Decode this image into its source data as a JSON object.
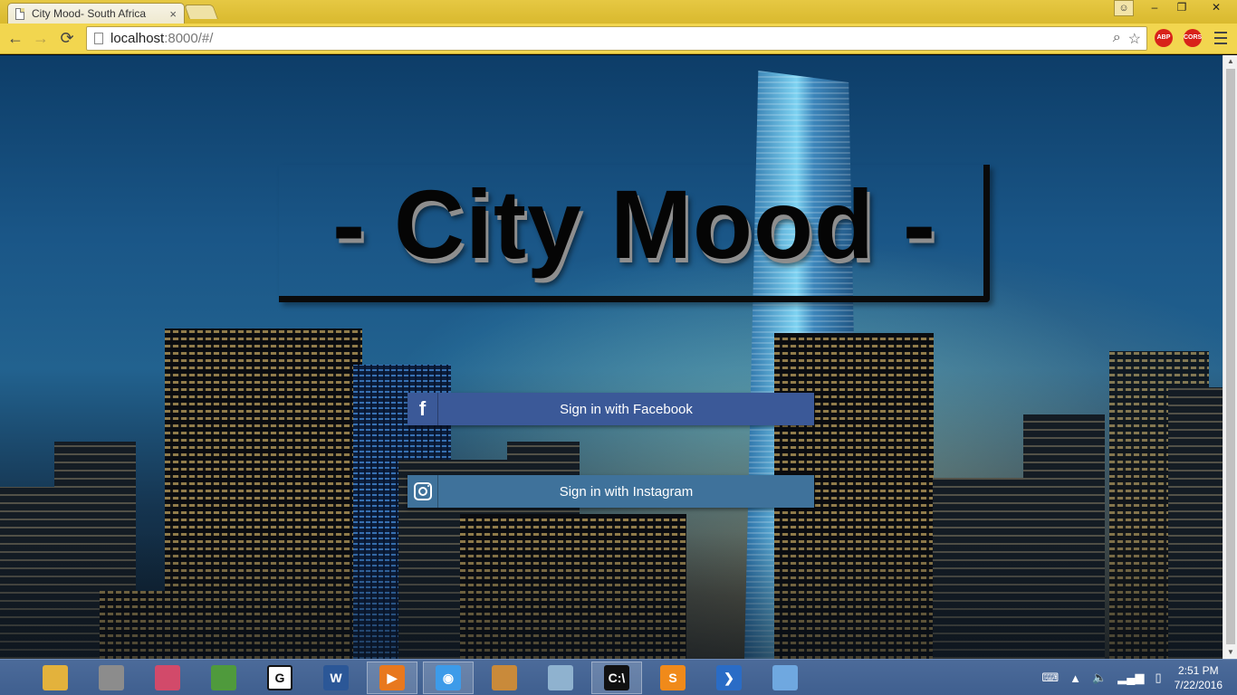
{
  "browser": {
    "tab_title": "City Mood- South Africa",
    "tab_close": "×",
    "url_host": "localhost",
    "url_path": ":8000/#/",
    "back": "←",
    "forward": "→",
    "reload": "⟳",
    "zoom_icon": "⌕",
    "bookmark_icon": "☆",
    "extensions": [
      "ABP",
      "CORS"
    ],
    "win_minimize": "–",
    "win_restore": "❐",
    "win_close": "✕",
    "profile_icon": "☺"
  },
  "page": {
    "title": "- City Mood -",
    "facebook_button": "Sign in with Facebook",
    "facebook_icon": "f",
    "instagram_button": "Sign in with Instagram"
  },
  "taskbar": {
    "apps": [
      {
        "name": "file-explorer-icon",
        "color": "#e3b23c",
        "glyph": ""
      },
      {
        "name": "firewall-icon",
        "color": "#8c8c8c",
        "glyph": ""
      },
      {
        "name": "paint-icon",
        "color": "#d24a6a",
        "glyph": ""
      },
      {
        "name": "notepad-chart-icon",
        "color": "#4f9a3c",
        "glyph": ""
      },
      {
        "name": "g-app-icon",
        "color": "#ffffff",
        "glyph": "G"
      },
      {
        "name": "word-icon",
        "color": "#2b5797",
        "glyph": "W"
      },
      {
        "name": "media-player-icon",
        "color": "#e8781e",
        "glyph": "▶"
      },
      {
        "name": "chrome-icon",
        "color": "#3d9be9",
        "glyph": "◉"
      },
      {
        "name": "palette-icon",
        "color": "#c98a3a",
        "glyph": ""
      },
      {
        "name": "monitor-icon",
        "color": "#8fb2cf",
        "glyph": ""
      },
      {
        "name": "command-prompt-icon",
        "color": "#111111",
        "glyph": "C:\\"
      },
      {
        "name": "sublime-icon",
        "color": "#f08a1a",
        "glyph": "S"
      },
      {
        "name": "powershell-icon",
        "color": "#2a6cc6",
        "glyph": "❯"
      },
      {
        "name": "window-app-icon",
        "color": "#6fa8e0",
        "glyph": ""
      }
    ],
    "time": "2:51 PM",
    "date": "7/22/2016"
  }
}
